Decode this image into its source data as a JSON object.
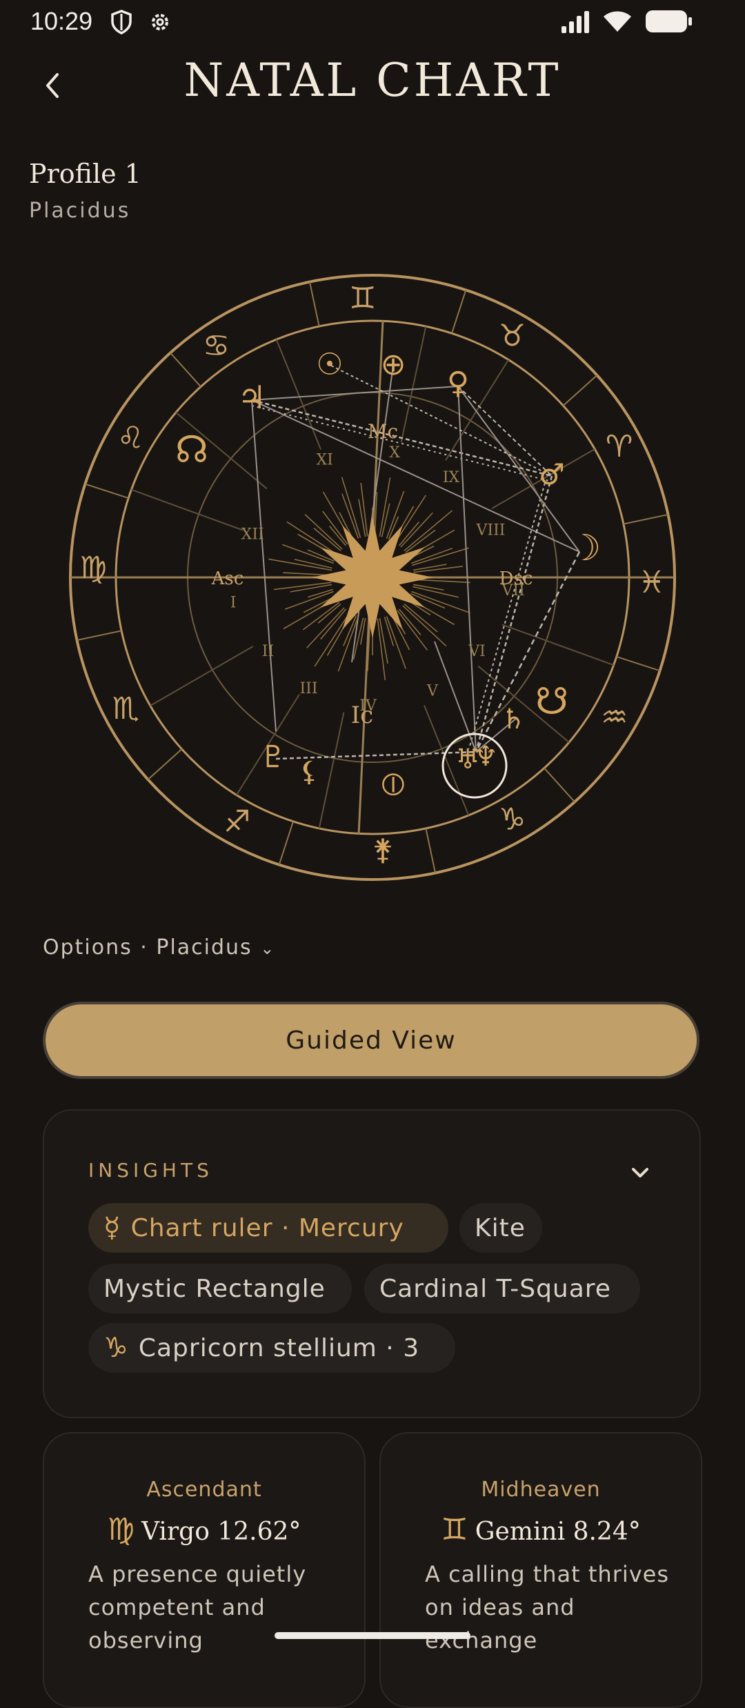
{
  "status_bar": {
    "time": "10:29"
  },
  "header": {
    "title": "NATAL CHART"
  },
  "profile": {
    "name": "Profile 1",
    "house_system": "Placidus"
  },
  "chart": {
    "angles": {
      "asc": "Asc",
      "dsc": "Dsc",
      "mc": "Mc",
      "ic": "Ic"
    },
    "houses": [
      "I",
      "II",
      "III",
      "IV",
      "V",
      "VI",
      "VII",
      "VIII",
      "IX",
      "X",
      "XI",
      "XII"
    ]
  },
  "options": {
    "label": "Options · Placidus",
    "caret": "⌄"
  },
  "guided_view": {
    "label": "Guided View"
  },
  "insights": {
    "title": "INSIGHTS",
    "chips": [
      {
        "glyph": "☿",
        "label": "Chart ruler · Mercury"
      },
      {
        "label": "Kite"
      },
      {
        "label": "Mystic Rectangle"
      },
      {
        "label": "Cardinal T-Square"
      },
      {
        "glyph": "♑",
        "label": "Capricorn stellium · 3"
      }
    ]
  },
  "cards": [
    {
      "label": "Ascendant",
      "glyph": "♍",
      "sign": "Virgo 12.62°",
      "text": "A presence quietly competent and observing"
    },
    {
      "label": "Midheaven",
      "glyph": "♊",
      "sign": "Gemini 8.24°",
      "text": "A calling that thrives on ideas and exchange"
    }
  ],
  "colors": {
    "accent": "#c19f68",
    "gold": "#c9a26a",
    "background": "#171412"
  }
}
